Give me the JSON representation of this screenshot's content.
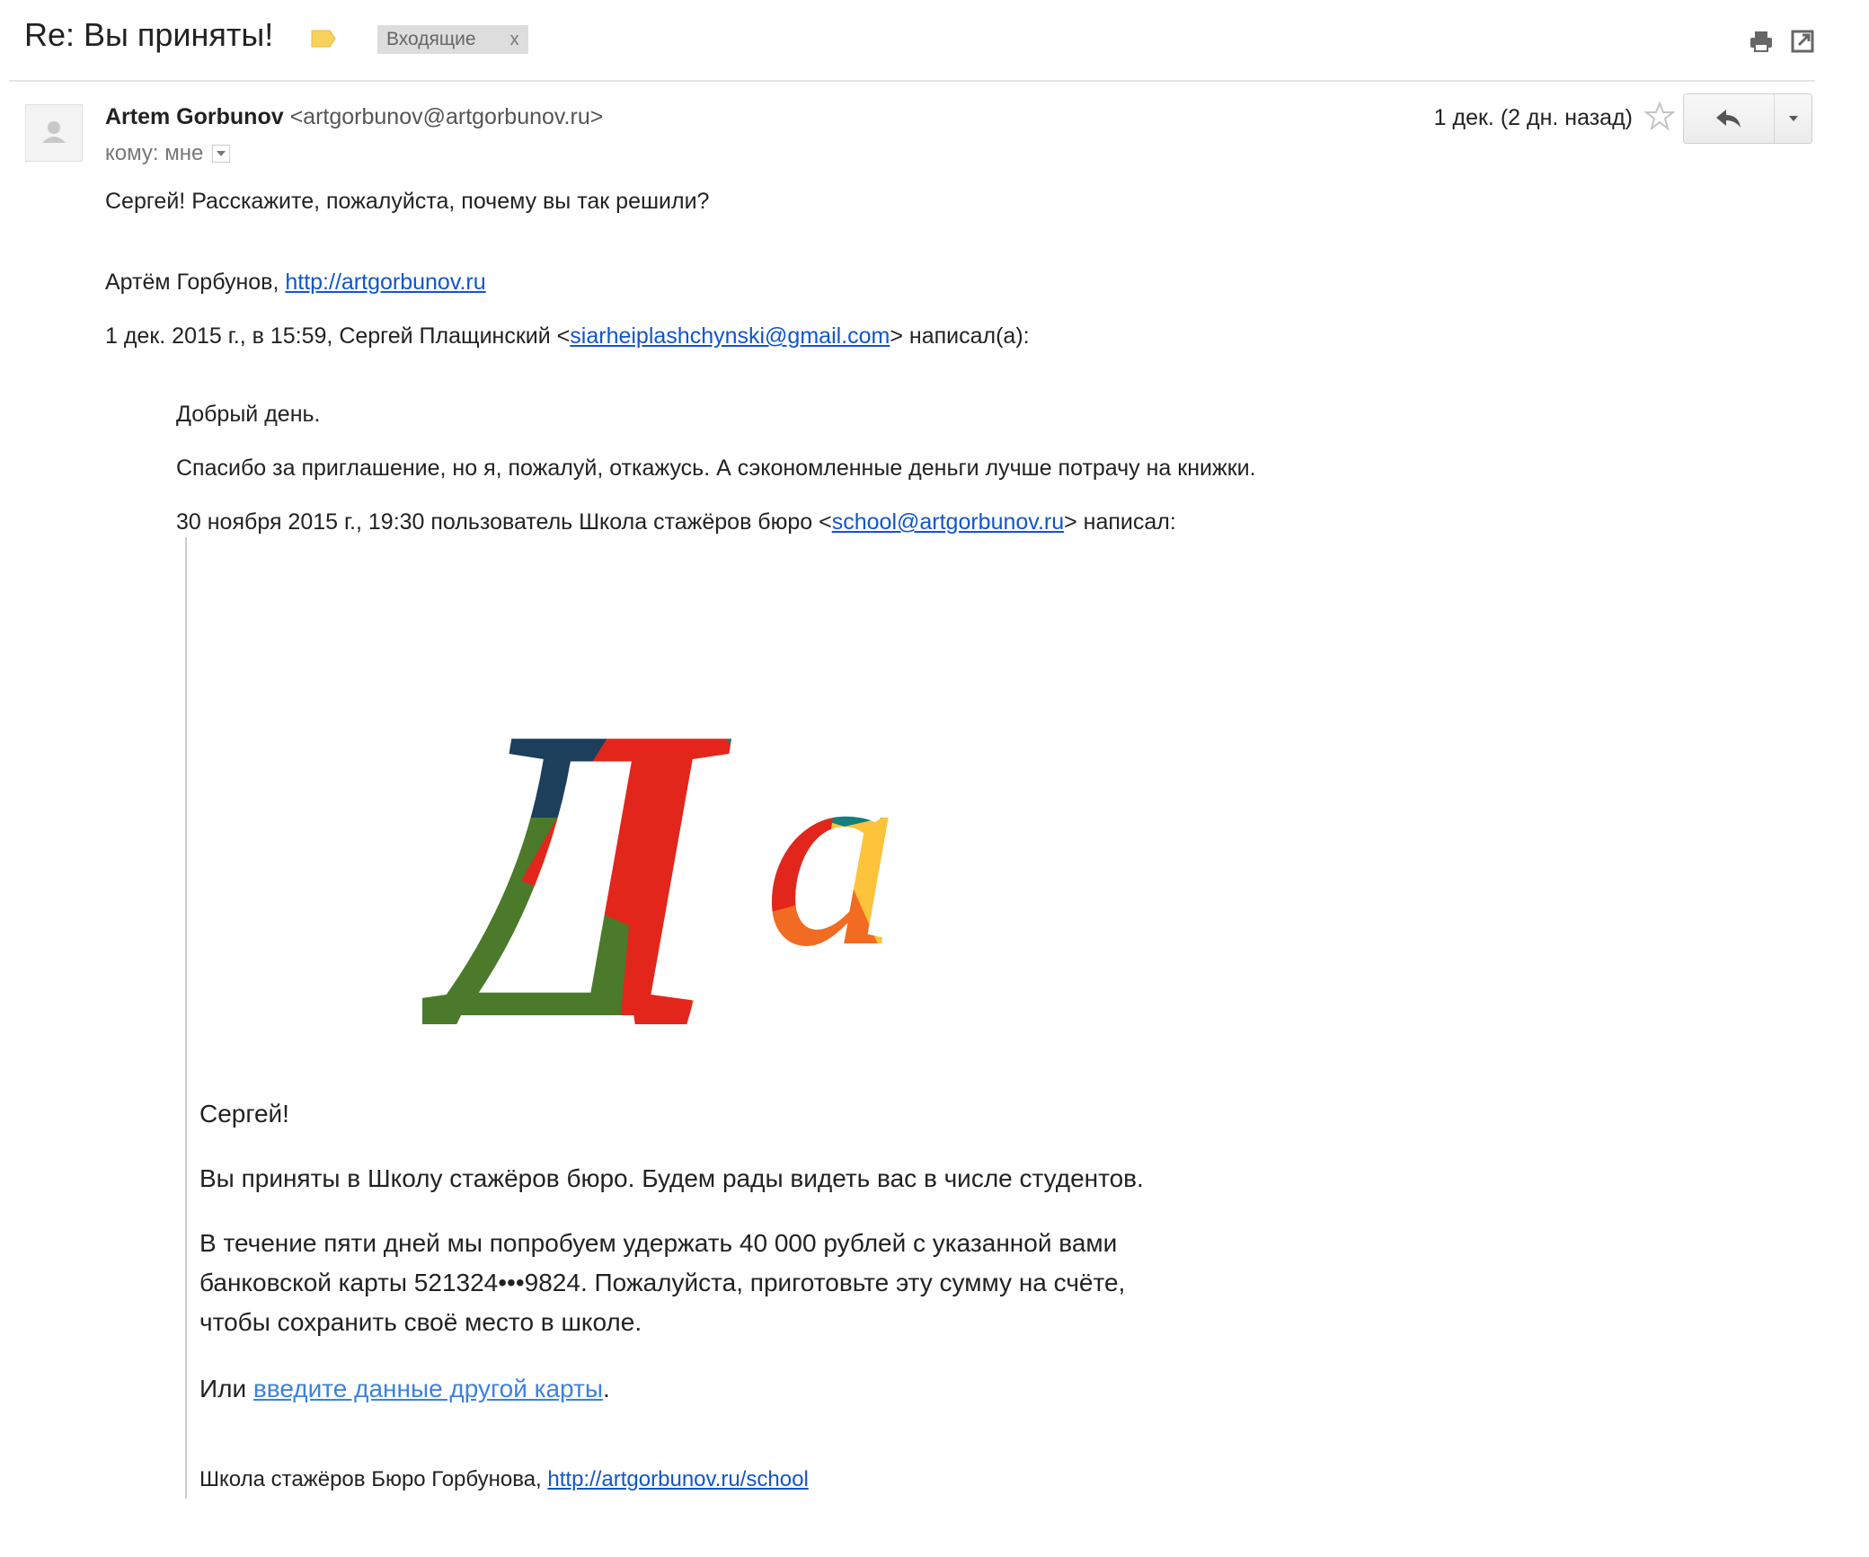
{
  "header": {
    "subject": "Re: Вы приняты!",
    "label_color": "#f8d25c",
    "inbox_label": "Входящие",
    "inbox_close": "x",
    "icons": [
      "print-icon",
      "new-window-icon"
    ]
  },
  "message": {
    "sender_name": "Artem Gorbunov",
    "sender_email": "<artgorbunov@artgorbunov.ru>",
    "to_me": "кому: мне",
    "date": "1 дек. (2 дн. назад)",
    "reply_icon": "reply-icon",
    "more_icon": "chevron-down-icon",
    "body_line1": "Сергей! Расскажите, пожалуйста, почему вы так решили?",
    "signature_name": "Артём Горбунов,",
    "signature_link": "http://artgorbunov.ru",
    "quote_header_prefix": "1 дек. 2015 г., в 15:59, Сергей Плащинский <",
    "quote_header_email": "siarheiplashchynski@gmail.com",
    "quote_header_suffix": "> написал(а):"
  },
  "quoted": {
    "greeting": "Добрый день.",
    "text": "Спасибо за приглашение, но я, пожалуй, откажусь. А сэкономленные деньги лучше потрачу на книжки.",
    "inner_header_prefix": "30 ноября 2015 г., 19:30 пользователь Школа стажёров бюро <",
    "inner_header_email": "school@artgorbunov.ru",
    "inner_header_suffix": "> написал:"
  },
  "inner": {
    "logo_text": "Да",
    "logo_colors": {
      "navy": "#1c3f5c",
      "green": "#4a7a2a",
      "teal": "#137f7f",
      "red": "#e3261c",
      "orange": "#f26b22",
      "yellow": "#fdc33a"
    },
    "greeting": "Сергей!",
    "line1": "Вы приняты в Школу стажёров бюро. Будем рады видеть вас в числе студентов.",
    "para_line1": "В течение пяти дней мы попробуем удержать 40 000 рублей с указанной вами",
    "para_line2": "банковской карты 521324•••9824. Пожалуйста, приготовьте эту сумму на счёте,",
    "para_line3": "чтобы сохранить своё место в школе.",
    "or_prefix": "Или ",
    "or_link": "введите данные другой карты",
    "or_suffix": ".",
    "footer_prefix": "Школа стажёров Бюро Горбунова,",
    "footer_link": "http://artgorbunov.ru/school"
  }
}
